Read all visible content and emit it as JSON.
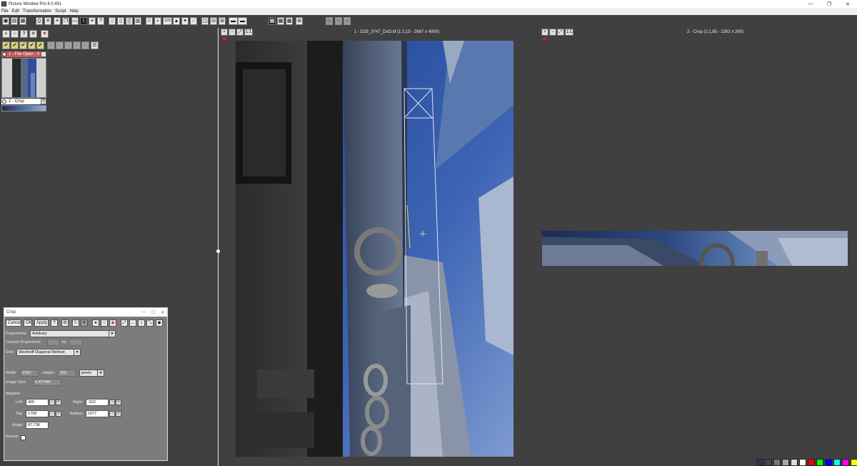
{
  "window": {
    "title": "Picture Window Pro 8.0.451",
    "controls": [
      "—",
      "❐",
      "✕"
    ]
  },
  "menu": [
    "File",
    "Edit",
    "Transformation",
    "Script",
    "Help"
  ],
  "left_panel": {
    "items": [
      {
        "label": "1 - File Open - 0"
      },
      {
        "label": "2 - Crop"
      }
    ]
  },
  "views": [
    {
      "title": "1 - DZ8_3747_DxO.tif (1:2,15 - 2667 x 4000)",
      "zoom_1to1": "1:1"
    },
    {
      "title": "2 - Crop (1:1,65 - 2262 x 265)",
      "zoom_1to1": "1:1"
    }
  ],
  "crop_dialog": {
    "title": "Crop",
    "buttons": {
      "cancel": "Cancel",
      "ok": "OK",
      "apply": "Apply"
    },
    "proportions_label": "Proportions:",
    "proportions_value": "Arbitrary",
    "custom_proportions_label": "Custom Proportions:",
    "custom_by": "by",
    "grid_label": "Grid:",
    "grid_value": "Westhoff Diagonal Method",
    "width_label": "Width:",
    "width_value": "2784",
    "height_label": "Height:",
    "height_value": "265",
    "units_value": "pixels",
    "image_size_label": "Image Size:",
    "image_size_value": "4,427MB",
    "margins_label": "Margins:",
    "left_label": "Left:",
    "left_value": "405",
    "right_label": "Right:",
    "right_value": "-522",
    "top_label": "Top:",
    "top_value": "1758",
    "bottom_label": "Bottom:",
    "bottom_value": "1977",
    "angle_label": "Angle:",
    "angle_value": "87,738",
    "resize_label": "Resize:"
  },
  "palette_colors": [
    "#2a3550",
    "#444444",
    "#777777",
    "#aaaaaa",
    "#dddddd",
    "#ffffff",
    "#ff0000",
    "#00ff00",
    "#0000ff",
    "#00ffff",
    "#ff00ff",
    "#ffff00"
  ]
}
